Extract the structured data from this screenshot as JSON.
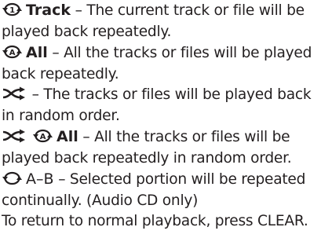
{
  "entries": [
    {
      "term": "Track",
      "dash": " – ",
      "line1": "The current track or file will be",
      "line2": "played back repeatedly.",
      "icon": "repeat-one-icon"
    },
    {
      "term": "All",
      "dash": " – ",
      "line1": "All the tracks or files will be played",
      "line2": "back repeatedly.",
      "icon": "repeat-all-icon"
    },
    {
      "term": "",
      "dash": " – ",
      "line1": "The tracks or files will be played back",
      "line2": "in random order.",
      "icon": "shuffle-icon"
    },
    {
      "term": "All",
      "dash": " – ",
      "line1": "All the tracks or files will be",
      "line2": "played back repeatedly in random order.",
      "icon": "shuffle-repeat-all-icon"
    },
    {
      "term": "A–B",
      "dash": " – ",
      "line1": "Selected portion will be repeated",
      "line2": "continually. (Audio CD only)",
      "icon": "repeat-ab-icon"
    }
  ],
  "footer": "To return to normal playback, press CLEAR.",
  "icon_glyphs": {
    "repeat_one": "1",
    "repeat_all": "A"
  },
  "colors": {
    "text": "#231f20"
  }
}
